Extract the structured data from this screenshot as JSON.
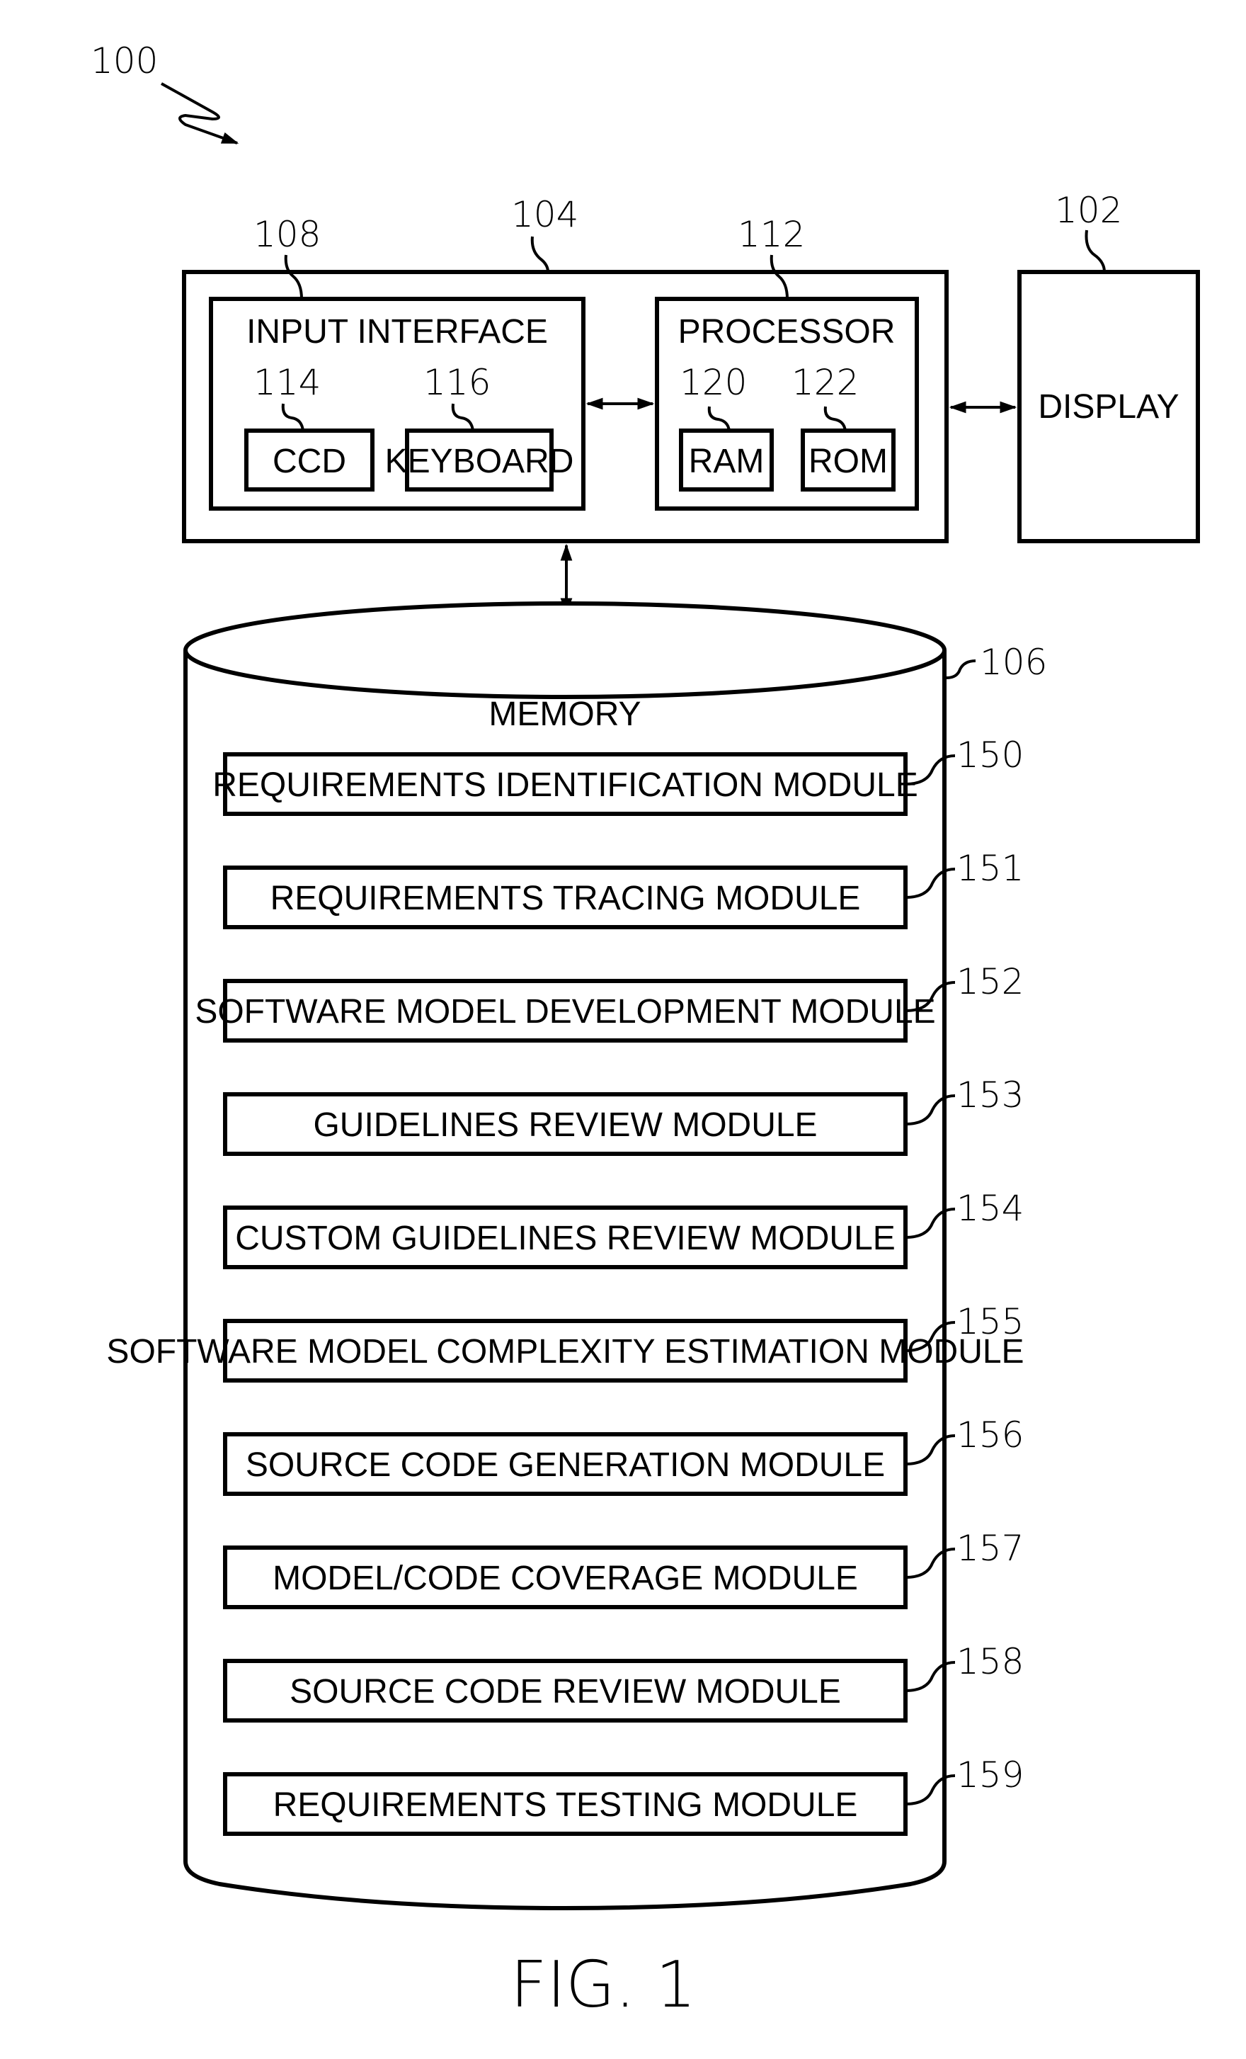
{
  "figure_label": "FIG. 1",
  "system": {
    "ref": "100"
  },
  "computer": {
    "ref": "104",
    "input_interface": {
      "ref": "108",
      "label": "INPUT INTERFACE",
      "children": [
        {
          "ref": "114",
          "label": "CCD"
        },
        {
          "ref": "116",
          "label": "KEYBOARD"
        }
      ]
    },
    "processor": {
      "ref": "112",
      "label": "PROCESSOR",
      "children": [
        {
          "ref": "120",
          "label": "RAM"
        },
        {
          "ref": "122",
          "label": "ROM"
        }
      ]
    }
  },
  "display": {
    "ref": "102",
    "label": "DISPLAY"
  },
  "memory": {
    "ref": "106",
    "label": "MEMORY",
    "modules": [
      {
        "ref": "150",
        "label": "REQUIREMENTS IDENTIFICATION MODULE"
      },
      {
        "ref": "151",
        "label": "REQUIREMENTS TRACING MODULE"
      },
      {
        "ref": "152",
        "label": "SOFTWARE MODEL DEVELOPMENT MODULE"
      },
      {
        "ref": "153",
        "label": "GUIDELINES REVIEW MODULE"
      },
      {
        "ref": "154",
        "label": "CUSTOM GUIDELINES REVIEW MODULE"
      },
      {
        "ref": "155",
        "label": "SOFTWARE MODEL COMPLEXITY ESTIMATION MODULE"
      },
      {
        "ref": "156",
        "label": "SOURCE CODE GENERATION MODULE"
      },
      {
        "ref": "157",
        "label": "MODEL/CODE COVERAGE MODULE"
      },
      {
        "ref": "158",
        "label": "SOURCE CODE REVIEW MODULE"
      },
      {
        "ref": "159",
        "label": "REQUIREMENTS TESTING MODULE"
      }
    ]
  },
  "connections": [
    {
      "from": "input-interface",
      "to": "processor",
      "type": "bidirectional"
    },
    {
      "from": "computer",
      "to": "display",
      "type": "bidirectional"
    },
    {
      "from": "computer",
      "to": "memory",
      "type": "bidirectional"
    }
  ]
}
